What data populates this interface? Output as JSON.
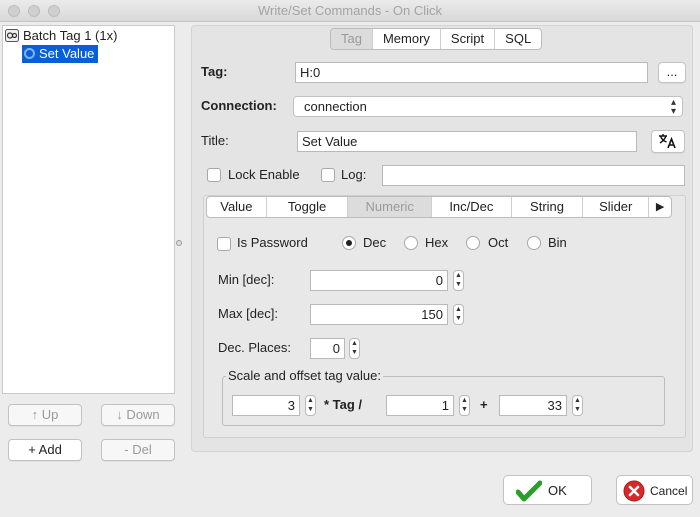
{
  "window": {
    "title": "Write/Set Commands - On Click"
  },
  "tree": {
    "root_label": "Batch Tag 1 (1x)",
    "child_label": "Set Value"
  },
  "left_buttons": {
    "up": "↑ Up",
    "down": "↓ Down",
    "add": "+ Add",
    "del": "- Del"
  },
  "top_tabs": [
    "Tag",
    "Memory",
    "Script",
    "SQL"
  ],
  "top_tabs_active": "Tag",
  "form": {
    "tag_label": "Tag:",
    "tag_value": "H:0",
    "browse_label": "...",
    "connection_label": "Connection:",
    "connection_value": "connection",
    "title_label": "Title:",
    "title_value": "Set Value",
    "translate_icon": "translate-icon",
    "lock_enable_label": "Lock Enable",
    "log_label": "Log:",
    "log_value": ""
  },
  "sub_tabs": [
    "Value",
    "Toggle",
    "Numeric",
    "Inc/Dec",
    "String",
    "Slider"
  ],
  "sub_tabs_active": "Numeric",
  "numeric": {
    "is_password_label": "Is Password",
    "radios": [
      "Dec",
      "Hex",
      "Oct",
      "Bin"
    ],
    "radio_selected": "Dec",
    "min_label": "Min [dec]:",
    "min_value": "0",
    "max_label": "Max [dec]:",
    "max_value": "150",
    "dec_places_label": "Dec. Places:",
    "dec_places_value": "0",
    "scale_title": "Scale and offset tag value:",
    "scale_value": "3",
    "tag_op_label": "* Tag /",
    "divisor_value": "1",
    "plus_label": "+",
    "offset_value": "33"
  },
  "footer": {
    "ok_label": "OK",
    "cancel_label": "Cancel"
  },
  "colors": {
    "selection": "#0a5fd6",
    "ok_check": "#2a9d2a",
    "cancel_red": "#d62a2a"
  }
}
